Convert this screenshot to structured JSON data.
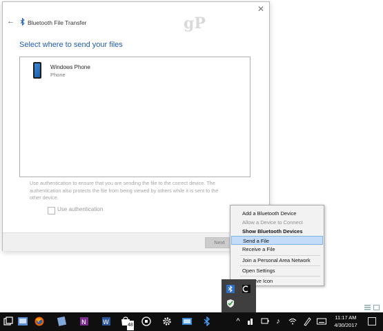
{
  "watermark": "gP",
  "wizard": {
    "title": "Bluetooth File Transfer",
    "heading": "Select where to send your files",
    "devices": [
      {
        "name": "Windows Phone",
        "type": "Phone"
      }
    ],
    "auth_note": "Use authentication to ensure that you are sending the file to the correct device. The authentication also protects the file from being viewed by others while it is sent to the other device.",
    "auth_checkbox_label": "Use authentication",
    "auth_checkbox_checked": false,
    "next_label": "Next"
  },
  "context_menu": {
    "items": [
      {
        "label": "Add a Bluetooth Device",
        "state": "normal"
      },
      {
        "label": "Allow a Device to Connect",
        "state": "disabled"
      },
      {
        "label": "Show Bluetooth Devices",
        "state": "bold"
      },
      {
        "label": "Send a File",
        "state": "highlighted"
      },
      {
        "label": "Receive a File",
        "state": "normal"
      },
      {
        "label": "Join a Personal Area Network",
        "state": "normal"
      },
      {
        "label": "Open Settings",
        "state": "normal"
      },
      {
        "label": "Remove Icon",
        "state": "normal"
      }
    ]
  },
  "taskbar": {
    "store_badge": "48",
    "time": "11:17 AM",
    "date": "4/30/2017"
  },
  "colors": {
    "accent": "#1f5bb3",
    "highlight": "#c4dcf7",
    "taskbar": "#0f0f0f"
  }
}
